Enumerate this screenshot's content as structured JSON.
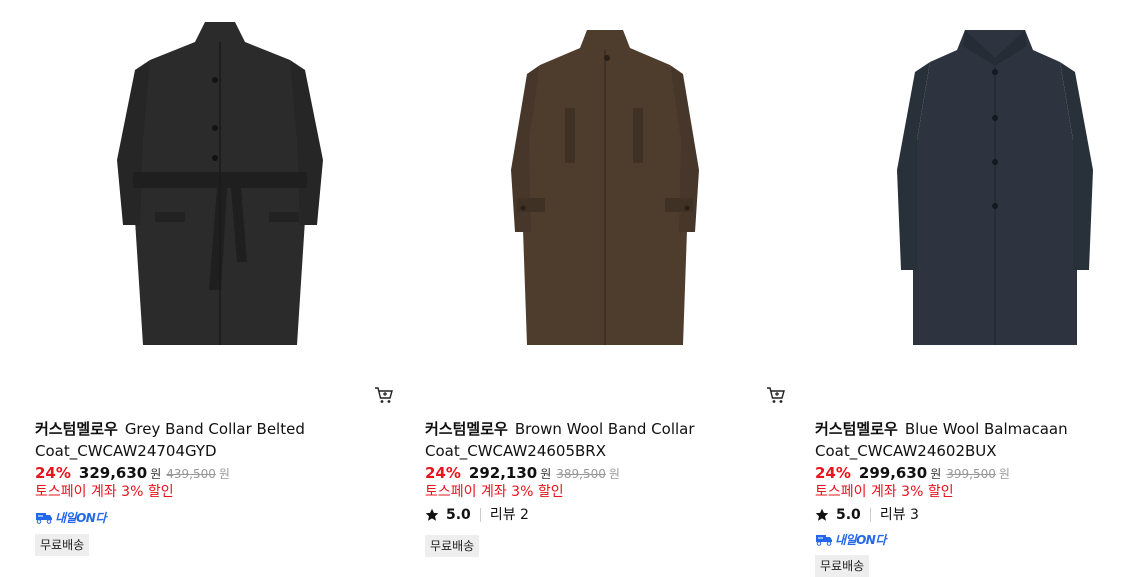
{
  "products": [
    {
      "brand": "커스텀멜로우",
      "name": "Grey Band Collar Belted Coat_CWCAW24704GYD",
      "discount": "24%",
      "price": "329,630",
      "currency": "원",
      "original_price": "439,500",
      "promo": "토스페이 계좌 3% 할인",
      "onda_label": "내일ON다",
      "shipping": "무료배송",
      "coat_color": "#2b2b2b"
    },
    {
      "brand": "커스텀멜로우",
      "name": "Brown Wool Band Collar Coat_CWCAW24605BRX",
      "discount": "24%",
      "price": "292,130",
      "currency": "원",
      "original_price": "389,500",
      "promo": "토스페이 계좌 3% 할인",
      "rating": "5.0",
      "review_label": "리뷰 2",
      "shipping": "무료배송",
      "coat_color": "#4e3d2d"
    },
    {
      "brand": "커스텀멜로우",
      "name": "Blue Wool Balmacaan Coat_CWCAW24602BUX",
      "discount": "24%",
      "price": "299,630",
      "currency": "원",
      "original_price": "399,500",
      "promo": "토스페이 계좌 3% 할인",
      "rating": "5.0",
      "review_label": "리뷰 3",
      "onda_label": "내일ON다",
      "shipping": "무료배송",
      "coat_color": "#2d3440"
    }
  ],
  "colors": {
    "discount": "#e8141e",
    "onda": "#2468ea"
  }
}
